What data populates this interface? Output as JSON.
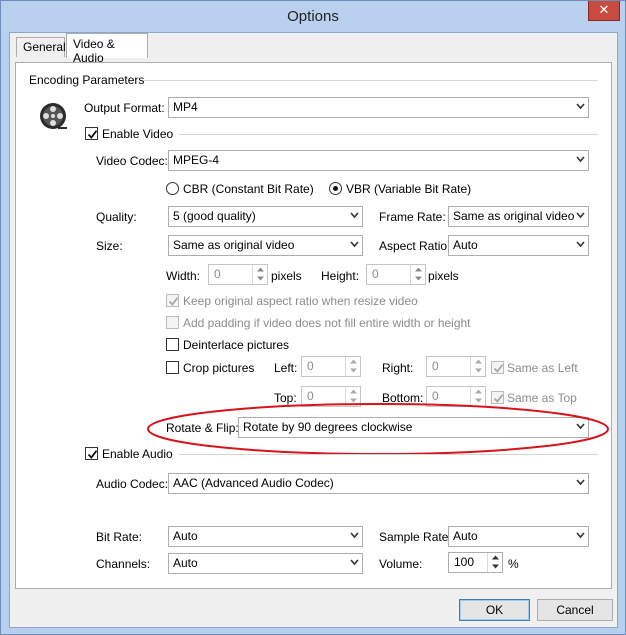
{
  "window": {
    "title": "Options",
    "close_glyph": "✕"
  },
  "tabs": [
    {
      "label": "General"
    },
    {
      "label": "Video & Audio"
    }
  ],
  "encoding": {
    "group_label": "Encoding Parameters",
    "output_format_label": "Output Format:",
    "output_format_value": "MP4"
  },
  "video": {
    "enable_label": "Enable Video",
    "enabled": true,
    "codec_label": "Video Codec:",
    "codec_value": "MPEG-4",
    "cbr_label": "CBR (Constant Bit Rate)",
    "vbr_label": "VBR (Variable Bit Rate)",
    "rate_mode": "VBR",
    "quality_label": "Quality:",
    "quality_value": "5 (good quality)",
    "frame_rate_label": "Frame Rate:",
    "frame_rate_value": "Same as original video",
    "size_label": "Size:",
    "size_value": "Same as original video",
    "aspect_label": "Aspect Ratio:",
    "aspect_value": "Auto",
    "width_label": "Width:",
    "width_value": "0",
    "width_unit": "pixels",
    "height_label": "Height:",
    "height_value": "0",
    "height_unit": "pixels",
    "keep_aspect_label": "Keep original aspect ratio when resize video",
    "add_padding_label": "Add padding if video does not fill entire width or height",
    "deinterlace_label": "Deinterlace pictures",
    "crop_label": "Crop pictures",
    "left_label": "Left:",
    "left_value": "0",
    "right_label": "Right:",
    "right_value": "0",
    "same_as_left_label": "Same as Left",
    "top_label": "Top:",
    "top_value": "0",
    "bottom_label": "Bottom:",
    "bottom_value": "0",
    "same_as_top_label": "Same as Top",
    "rotate_label": "Rotate & Flip:",
    "rotate_value": "Rotate by 90 degrees clockwise"
  },
  "audio": {
    "enable_label": "Enable Audio",
    "enabled": true,
    "codec_label": "Audio Codec:",
    "codec_value": "AAC (Advanced Audio Codec)",
    "bitrate_label": "Bit Rate:",
    "bitrate_value": "Auto",
    "sample_rate_label": "Sample Rate:",
    "sample_rate_value": "Auto",
    "channels_label": "Channels:",
    "channels_value": "Auto",
    "volume_label": "Volume:",
    "volume_value": "100",
    "volume_unit": "%"
  },
  "footer": {
    "ok_label": "OK",
    "cancel_label": "Cancel"
  },
  "colors": {
    "annotation_ellipse": "#d9131b",
    "title_bar": "#b9d1ef"
  }
}
